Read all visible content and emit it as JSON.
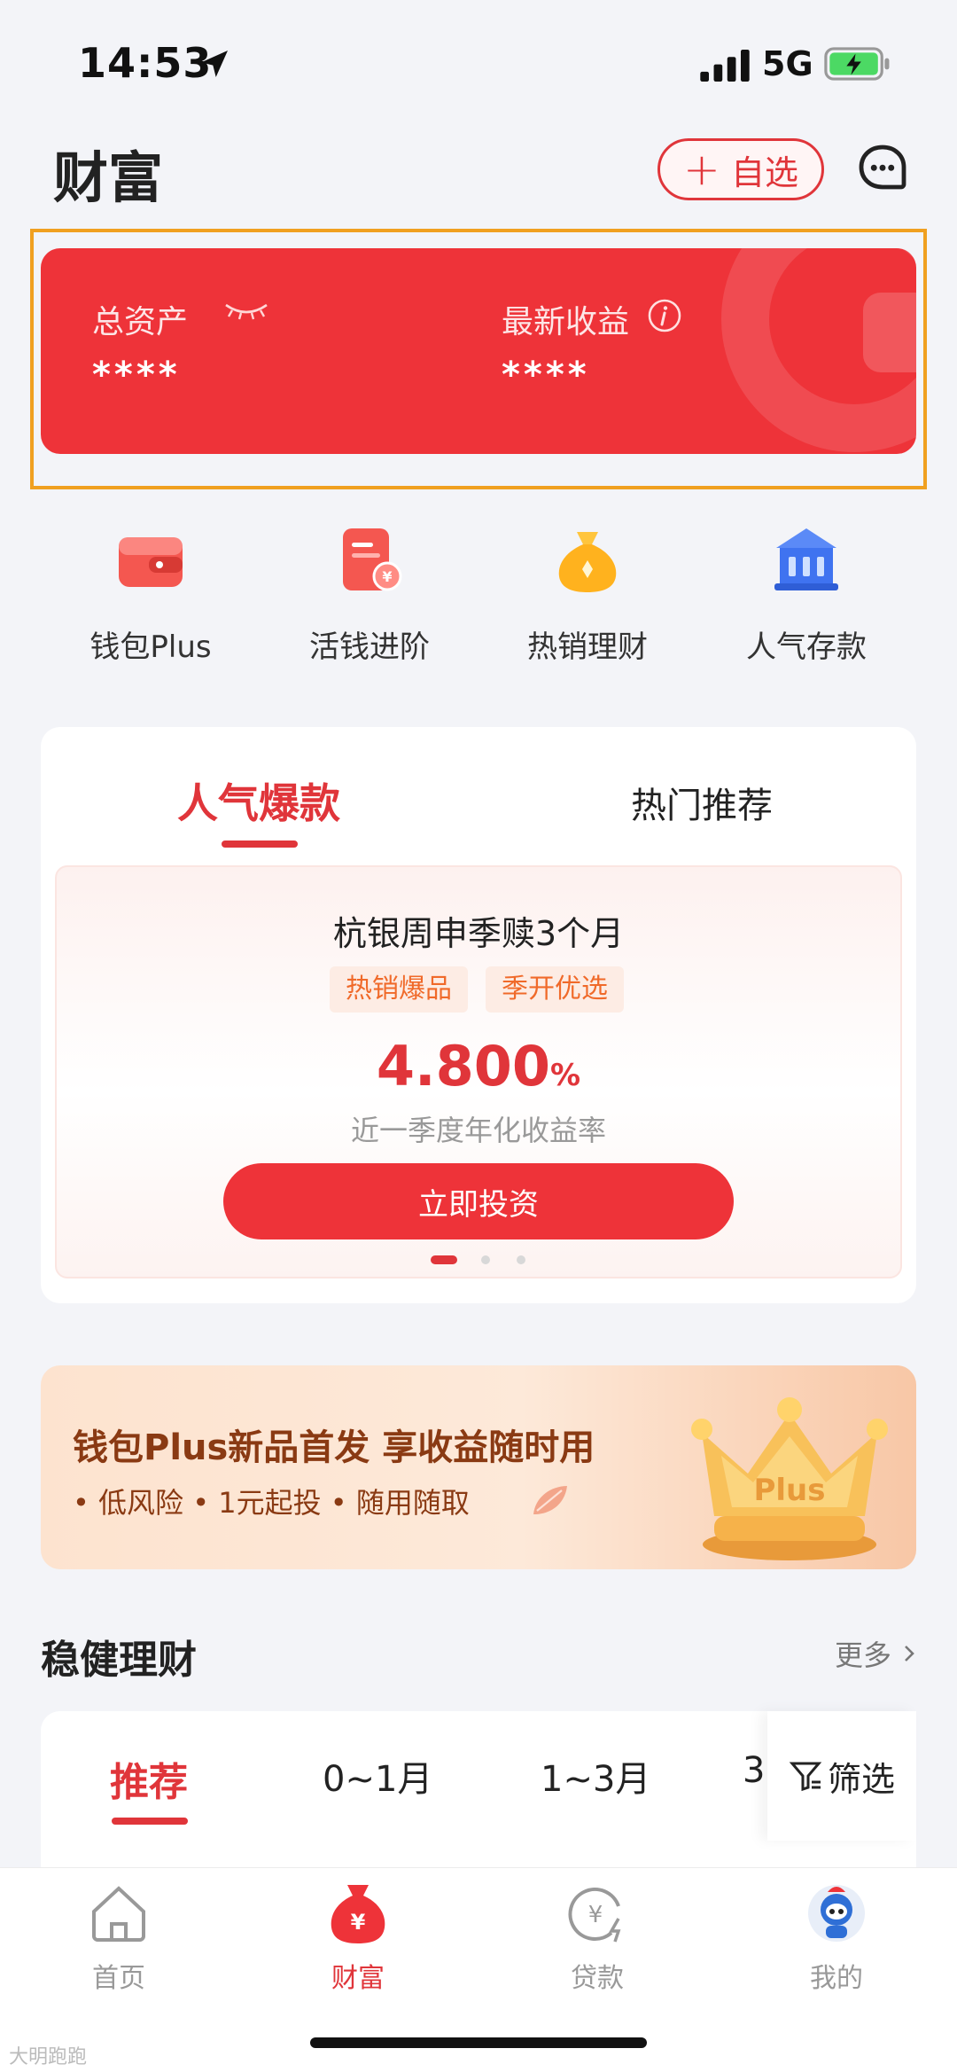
{
  "status_bar": {
    "time": "14:53",
    "network": "5G"
  },
  "header": {
    "title": "财富",
    "add_watch_label": "自选"
  },
  "assets": {
    "total_label": "总资产",
    "total_value": "****",
    "latest_income_label": "最新收益",
    "latest_income_value": "****"
  },
  "quick_entries": [
    {
      "label": "钱包Plus",
      "icon": "wallet-icon"
    },
    {
      "label": "活钱进阶",
      "icon": "document-yuan-icon"
    },
    {
      "label": "热销理财",
      "icon": "money-bag-icon"
    },
    {
      "label": "人气存款",
      "icon": "bank-icon"
    }
  ],
  "products": {
    "tabs": [
      {
        "label": "人气爆款"
      },
      {
        "label": "热门推荐"
      }
    ],
    "active_tab": 0,
    "card": {
      "name": "杭银周申季赎3个月",
      "tags": [
        "热销爆品",
        "季开优选"
      ],
      "rate_number": "4.800",
      "rate_unit": "%",
      "rate_desc": "近一季度年化收益率",
      "button_label": "立即投资"
    },
    "page_count": 3,
    "active_page": 0
  },
  "banner": {
    "title": "钱包Plus新品首发  享收益随时用",
    "subtitle": "• 低风险 • 1元起投 • 随用随取",
    "crown_text": "Plus"
  },
  "stable_finance": {
    "title": "稳健理财",
    "more_label": "更多",
    "tabs": [
      "推荐",
      "0~1月",
      "1~3月",
      "3"
    ],
    "active_tab": 0,
    "filter_label": "筛选"
  },
  "bottom_nav": {
    "items": [
      {
        "label": "首页",
        "icon": "home-icon"
      },
      {
        "label": "财富",
        "icon": "money-bag-icon"
      },
      {
        "label": "贷款",
        "icon": "loan-icon"
      },
      {
        "label": "我的",
        "icon": "avatar-icon"
      }
    ],
    "active_index": 1
  },
  "watermark": "大明跑跑",
  "colors": {
    "accent": "#e0353a",
    "card_red": "#ee3339",
    "highlight": "#f0a020",
    "tag_text": "#f06a2a"
  }
}
